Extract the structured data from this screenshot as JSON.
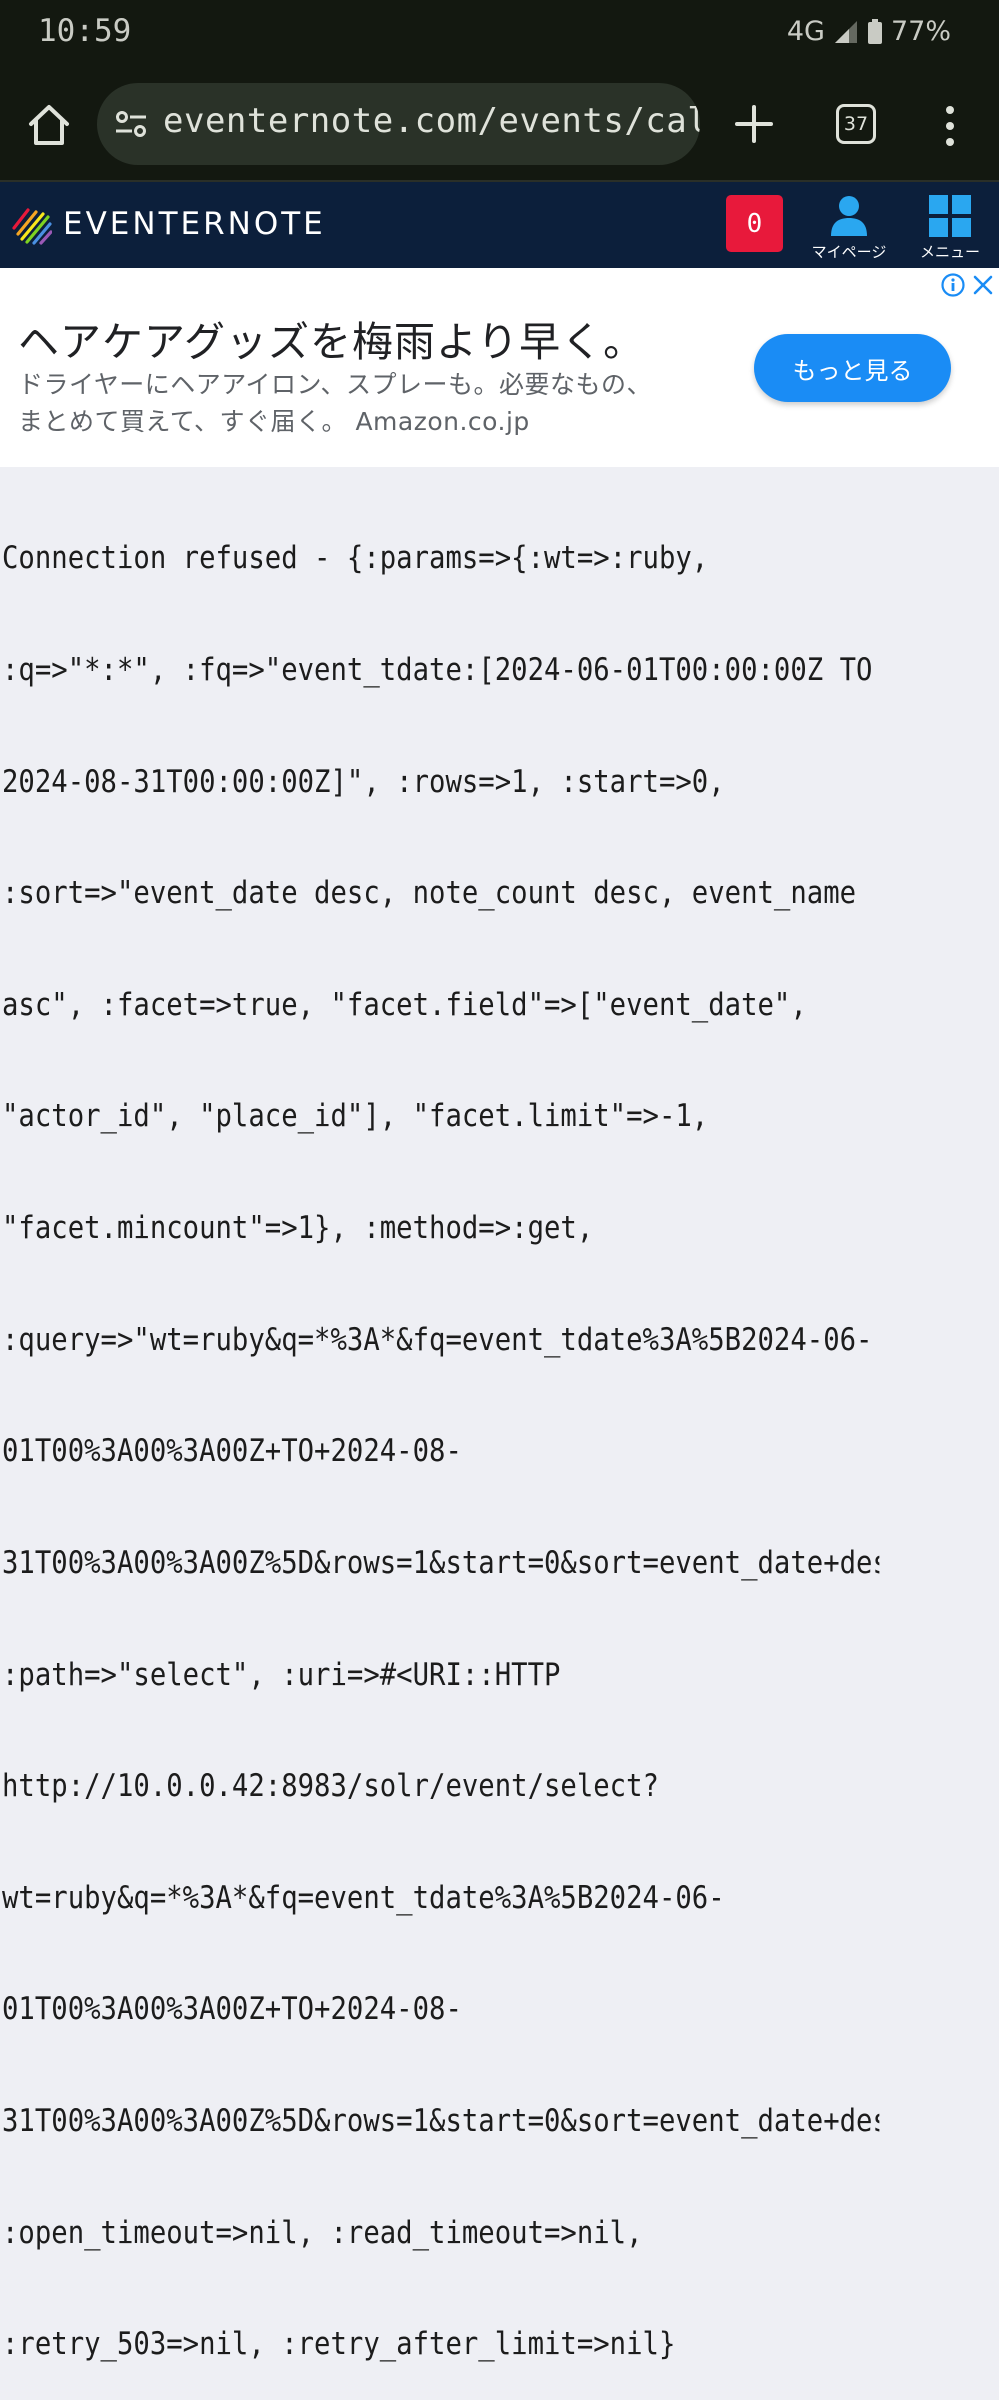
{
  "status_bar": {
    "time": "10:59",
    "network": "4G",
    "battery": "77%"
  },
  "browser": {
    "url": "eventernote.com/events/caler",
    "tab_count": "37"
  },
  "site_header": {
    "logo_text": "EVENTERNOTE",
    "notification_count": "0",
    "mypage_label": "マイページ",
    "menu_label": "メニュー"
  },
  "ad": {
    "headline": "ヘアケアグッズを梅雨より早く。",
    "body_line1": "ドライヤーにヘアアイロン、スプレーも。必要なもの、",
    "body_line2": "まとめて買えて、すぐ届く。 Amazon.co.jp",
    "cta": "もっと見る"
  },
  "error_lines": [
    "Connection refused - {:params=>{:wt=>:ruby,",
    ":q=>\"*:*\", :fq=>\"event_tdate:[2024-06-01T00:00:00Z TO",
    "2024-08-31T00:00:00Z]\", :rows=>1, :start=>0,",
    ":sort=>\"event_date desc, note_count desc, event_name",
    "asc\", :facet=>true, \"facet.field\"=>[\"event_date\",",
    "\"actor_id\", \"place_id\"], \"facet.limit\"=>-1,",
    "\"facet.mincount\"=>1}, :method=>:get,",
    ":query=>\"wt=ruby&q=*%3A*&fq=event_tdate%3A%5B2024-06-",
    "01T00%3A00%3A00Z+TO+2024-08-",
    "31T00%3A00%3A00Z%5D&rows=1&start=0&sort=event_date+des",
    ":path=>\"select\", :uri=>#<URI::HTTP",
    "http://10.0.0.42:8983/solr/event/select?",
    "wt=ruby&q=*%3A*&fq=event_tdate%3A%5B2024-06-",
    "01T00%3A00%3A00Z+TO+2024-08-",
    "31T00%3A00%3A00Z%5D&rows=1&start=0&sort=event_date+des",
    ":open_timeout=>nil, :read_timeout=>nil,",
    ":retry_503=>nil, :retry_after_limit=>nil}"
  ]
}
